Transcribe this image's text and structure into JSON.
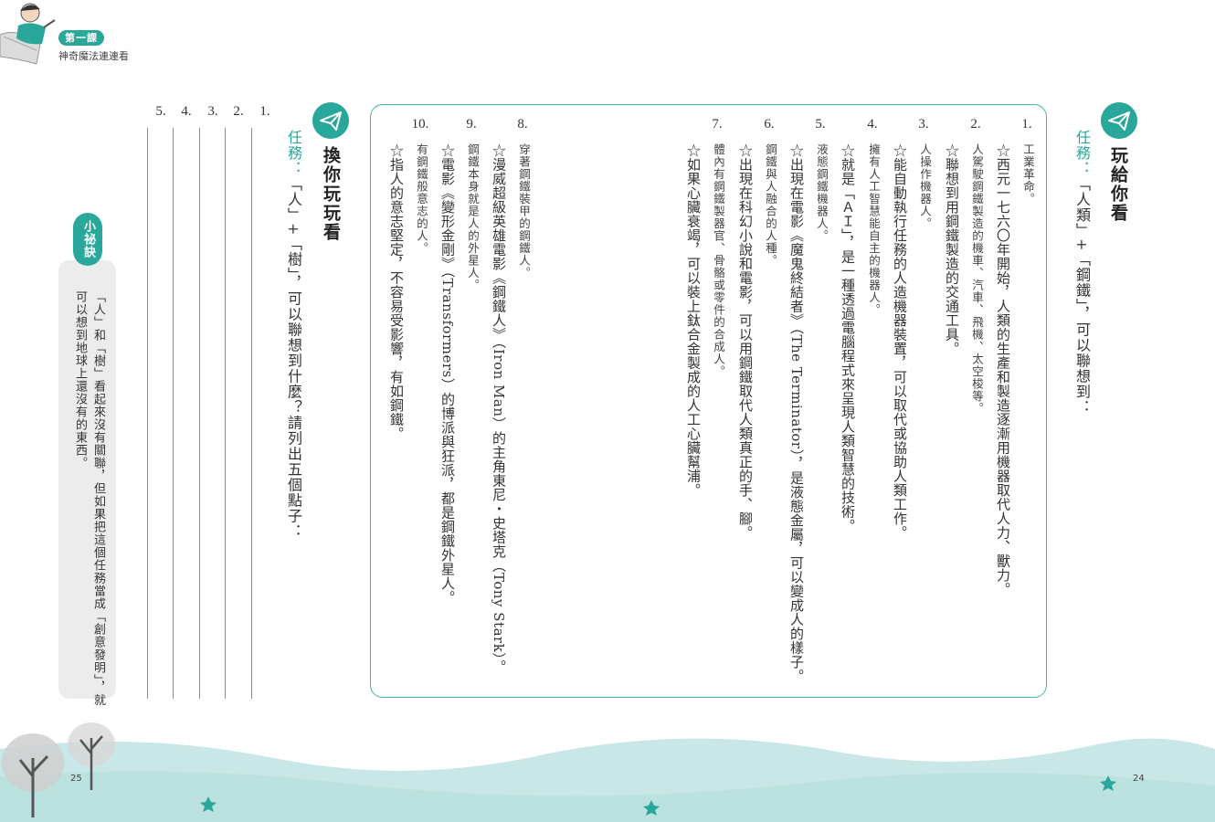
{
  "header": {
    "lesson_badge": "第一課",
    "lesson_title": "神奇魔法連連看"
  },
  "right_section": {
    "heading": "玩給你看",
    "task_label": "任務：",
    "task_text": "「人類」+「鋼鐵」，可以聯想到：",
    "items": [
      {
        "num": "1.",
        "main": "",
        "sub": "工業革命。",
        "main2": "☆西元一七六〇年開始，人類的生產和製造逐漸用機器取代人力、獸力。"
      },
      {
        "num": "2.",
        "sub": "人駕駛鋼鐵製造的機車、汽車、飛機、太空梭等。",
        "main2": "☆聯想到用鋼鐵製造的交通工具。"
      },
      {
        "num": "3.",
        "sub": "人操作機器人。",
        "main2": "☆能自動執行任務的人造機器裝置，可以取代或協助人類工作。"
      },
      {
        "num": "4.",
        "sub": "擁有人工智慧能自主的機器人。",
        "main2": "☆就是「ＡＩ」，是一種透過電腦程式來呈現人類智慧的技術。"
      },
      {
        "num": "5.",
        "sub": "液態鋼鐵機器人。",
        "main2": "☆出現在電影《魔鬼終結者》（The Terminator），是液態金屬，可以變成人的樣子。"
      },
      {
        "num": "6.",
        "sub": "鋼鐵與人融合的人種。",
        "main2": "☆出現在科幻小說和電影，可以用鋼鐵取代人類真正的手、腳。"
      },
      {
        "num": "7.",
        "sub": "體內有鋼鐵製器官、骨骼或零件的合成人。",
        "main2": "☆如果心臟衰竭，可以裝上鈦合金製成的人工心臟幫浦。"
      },
      {
        "num": "8.",
        "sub": "穿著鋼鐵裝甲的鋼鐵人。",
        "main2": "☆漫威超級英雄電影《鋼鐵人》（Iron Man）的主角東尼・史塔克（Tony Stark）。"
      },
      {
        "num": "9.",
        "sub": "鋼鐵本身就是人的外星人。",
        "main2": "☆電影《變形金剛》（Transformers）的博派與狂派，都是鋼鐵外星人。"
      },
      {
        "num": "10.",
        "sub": "有鋼鐵般意志的人。",
        "main2": "☆指人的意志堅定，不容易受影響，有如鋼鐵。"
      }
    ]
  },
  "left_section": {
    "heading": "換你玩玩看",
    "task_label": "任務：",
    "task_text": "「人」+「樹」，可以聯想到什麼？請列出五個點子：",
    "answer_numbers": [
      "1.",
      "2.",
      "3.",
      "4.",
      "5."
    ]
  },
  "tip": {
    "badge": "小祕訣",
    "line1": "「人」和「樹」看起來沒有關聯，但如果把這個任務當成「創意發明」，就",
    "line2": "可以想到地球上還沒有的東西。"
  },
  "page_numbers": {
    "left": "25",
    "right": "24"
  },
  "colors": {
    "accent": "#2aa79b",
    "box_border": "#45b5aa",
    "hill": "#c9e7e6"
  },
  "icons": [
    "paper-plane-icon",
    "tree-illustration",
    "character-illustration"
  ]
}
